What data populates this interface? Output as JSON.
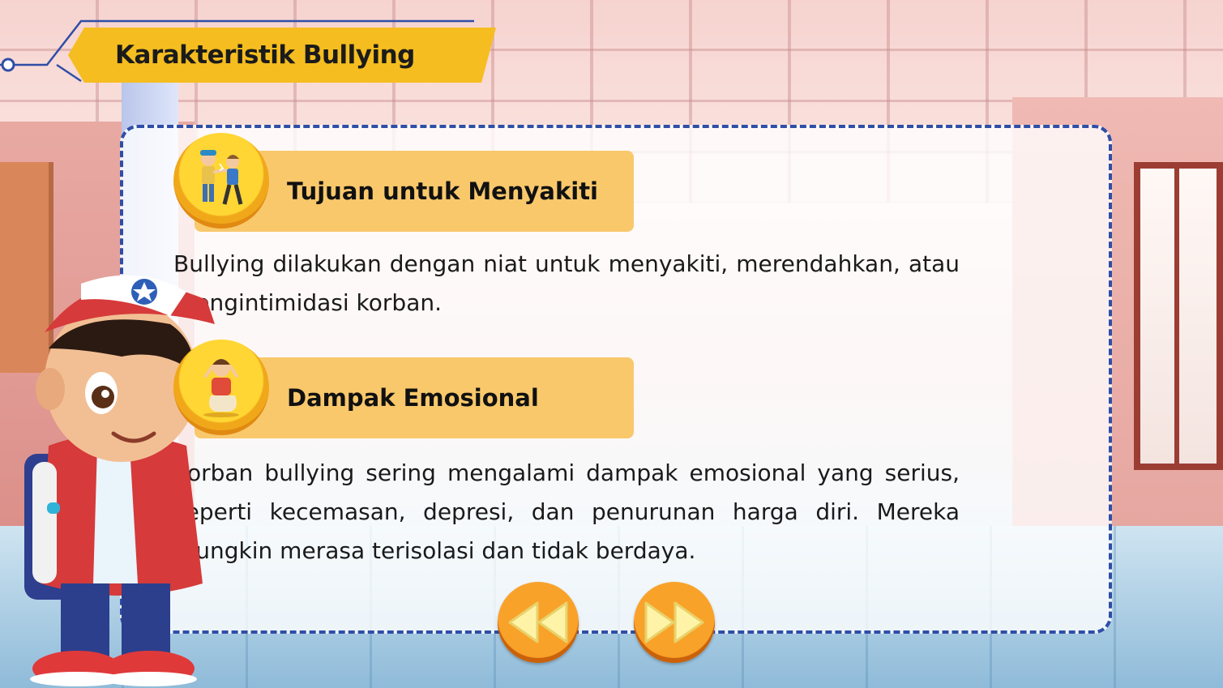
{
  "page": {
    "title": "Karakteristik Bullying"
  },
  "sections": [
    {
      "title": "Tujuan untuk Menyakiti",
      "icon": "pushing-kids-icon",
      "text": "Bullying dilakukan dengan niat untuk menyakiti, merendahkan, atau mengintimidasi korban."
    },
    {
      "title": "Dampak Emosional",
      "icon": "sad-kid-icon",
      "text": "Korban bullying sering mengalami dampak emosional yang serius, seperti kecemasan, depresi, dan penurunan harga diri. Mereka mungkin merasa terisolasi dan tidak berdaya."
    }
  ],
  "navigation": {
    "prev_icon": "rewind-icon",
    "next_icon": "fast-forward-icon"
  },
  "colors": {
    "banner": "#f5bd1f",
    "section_bar": "#f9c86b",
    "card_border": "#2f4ea6",
    "nav_button": "#f9a22a"
  }
}
